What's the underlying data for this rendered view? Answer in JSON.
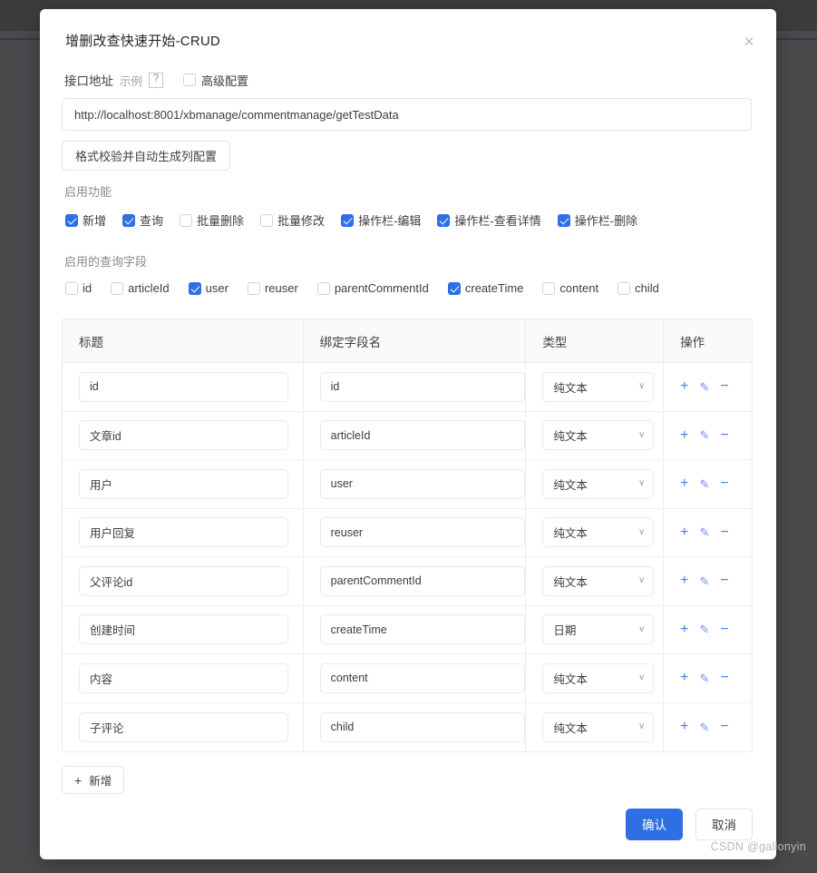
{
  "dialog": {
    "title": "增删改查快速开始-CRUD",
    "close_icon": "✕"
  },
  "api": {
    "label": "接口地址",
    "example_label": "示例",
    "help_icon": "?",
    "advanced_label": "高级配置",
    "advanced_checked": false,
    "url_value": "http://localhost:8001/xbmanage/commentmanage/getTestData",
    "generate_button": "格式校验并自动生成列配置"
  },
  "features": {
    "label": "启用功能",
    "items": [
      {
        "label": "新增",
        "checked": true
      },
      {
        "label": "查询",
        "checked": true
      },
      {
        "label": "批量删除",
        "checked": false
      },
      {
        "label": "批量修改",
        "checked": false
      },
      {
        "label": "操作栏-编辑",
        "checked": true
      },
      {
        "label": "操作栏-查看详情",
        "checked": true
      },
      {
        "label": "操作栏-删除",
        "checked": true
      }
    ]
  },
  "query_fields": {
    "label": "启用的查询字段",
    "items": [
      {
        "label": "id",
        "checked": false
      },
      {
        "label": "articleId",
        "checked": false
      },
      {
        "label": "user",
        "checked": true
      },
      {
        "label": "reuser",
        "checked": false
      },
      {
        "label": "parentCommentId",
        "checked": false
      },
      {
        "label": "createTime",
        "checked": true
      },
      {
        "label": "content",
        "checked": false
      },
      {
        "label": "child",
        "checked": false
      }
    ]
  },
  "table": {
    "headers": [
      "标题",
      "绑定字段名",
      "类型",
      "操作"
    ],
    "rows": [
      {
        "title": "id",
        "field": "id",
        "type": "纯文本"
      },
      {
        "title": "文章id",
        "field": "articleId",
        "type": "纯文本"
      },
      {
        "title": "用户",
        "field": "user",
        "type": "纯文本"
      },
      {
        "title": "用户回复",
        "field": "reuser",
        "type": "纯文本"
      },
      {
        "title": "父评论id",
        "field": "parentCommentId",
        "type": "纯文本"
      },
      {
        "title": "创建时间",
        "field": "createTime",
        "type": "日期"
      },
      {
        "title": "内容",
        "field": "content",
        "type": "纯文本"
      },
      {
        "title": "子评论",
        "field": "child",
        "type": "纯文本"
      }
    ],
    "row_actions": {
      "add_icon": "+",
      "edit_icon": "✎",
      "remove_icon": "−"
    },
    "add_row_button": "新增",
    "add_row_icon": "+"
  },
  "footer": {
    "confirm_label": "确认",
    "cancel_label": "取消"
  },
  "watermark": "CSDN @gallonyin",
  "colors": {
    "accent": "#2f6fe4",
    "action_icon": "#4a7cf0",
    "backdrop": "#4a4a4d",
    "header_bg": "#fafafa"
  }
}
